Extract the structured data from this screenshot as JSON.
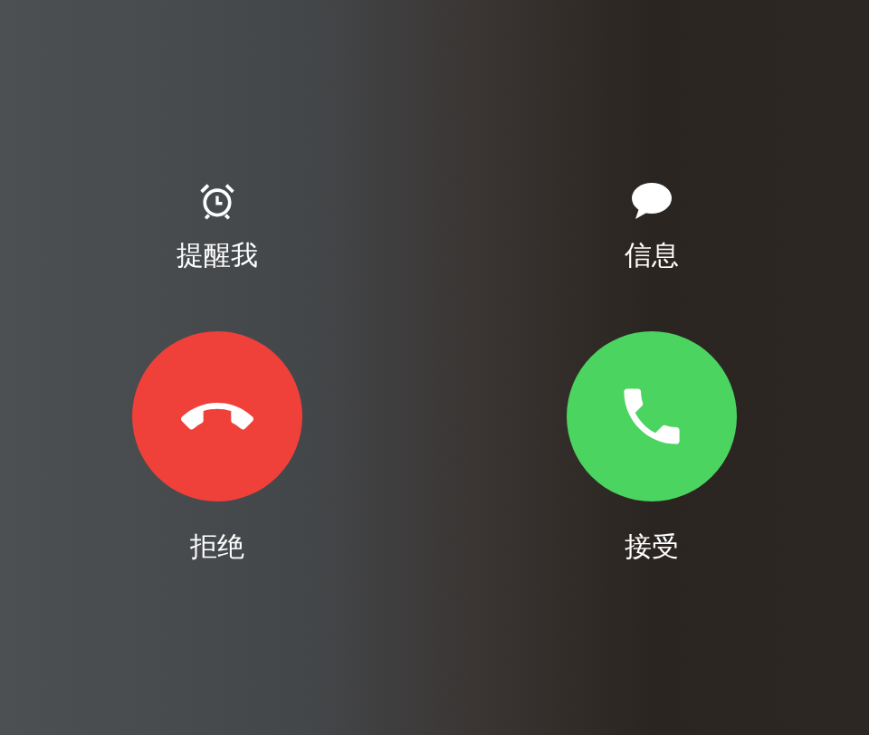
{
  "actions": [
    {
      "kind": "alarm",
      "label": "提醒我"
    },
    {
      "kind": "message",
      "label": "信息"
    }
  ],
  "call_buttons": [
    {
      "kind": "decline",
      "label": "拒绝"
    },
    {
      "kind": "accept",
      "label": "接受"
    }
  ]
}
